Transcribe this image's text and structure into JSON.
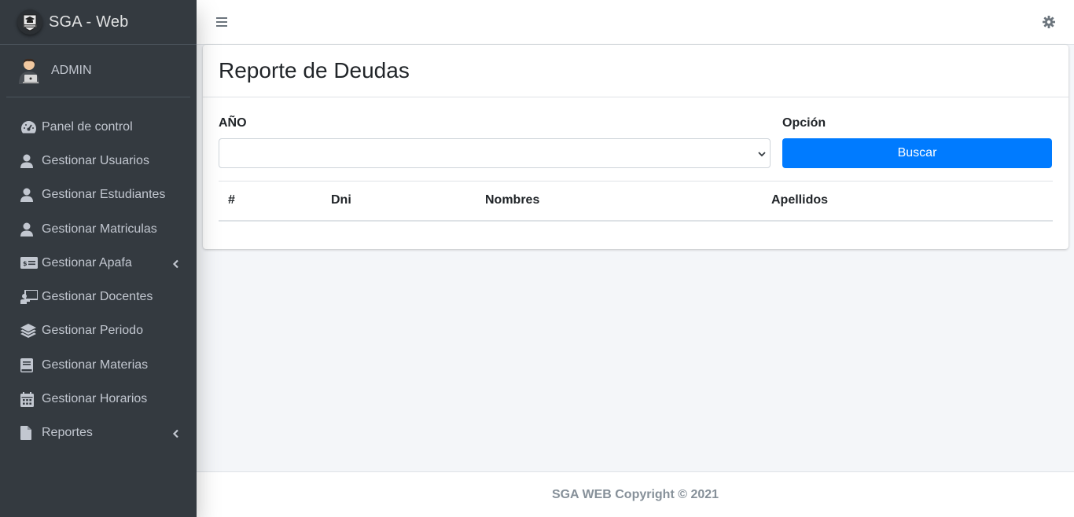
{
  "app": {
    "title": "SGA - Web"
  },
  "user": {
    "name": "ADMIN"
  },
  "sidebar": {
    "items": [
      {
        "label": "Panel de control",
        "icon": "tachometer-icon"
      },
      {
        "label": "Gestionar Usuarios",
        "icon": "user-icon"
      },
      {
        "label": "Gestionar Estudiantes",
        "icon": "user-icon"
      },
      {
        "label": "Gestionar Matriculas",
        "icon": "user-icon"
      },
      {
        "label": "Gestionar Apafa",
        "icon": "money-bill-icon",
        "has_submenu": true
      },
      {
        "label": "Gestionar Docentes",
        "icon": "chalkboard-teacher-icon"
      },
      {
        "label": "Gestionar Periodo",
        "icon": "layer-group-icon"
      },
      {
        "label": "Gestionar Materias",
        "icon": "book-icon"
      },
      {
        "label": "Gestionar Horarios",
        "icon": "calendar-icon"
      },
      {
        "label": "Reportes",
        "icon": "file-icon",
        "has_submenu": true
      }
    ]
  },
  "page": {
    "title": "Reporte de Deudas",
    "year_label": "AÑO",
    "year_value": "",
    "option_label": "Opción",
    "search_button": "Buscar"
  },
  "table": {
    "columns": [
      "#",
      "Dni",
      "Nombres",
      "Apellidos"
    ],
    "rows": []
  },
  "footer": {
    "text": "SGA WEB Copyright © 2021"
  },
  "colors": {
    "sidebar": "#343a40",
    "primary": "#007bff",
    "background": "#f4f6f9"
  }
}
